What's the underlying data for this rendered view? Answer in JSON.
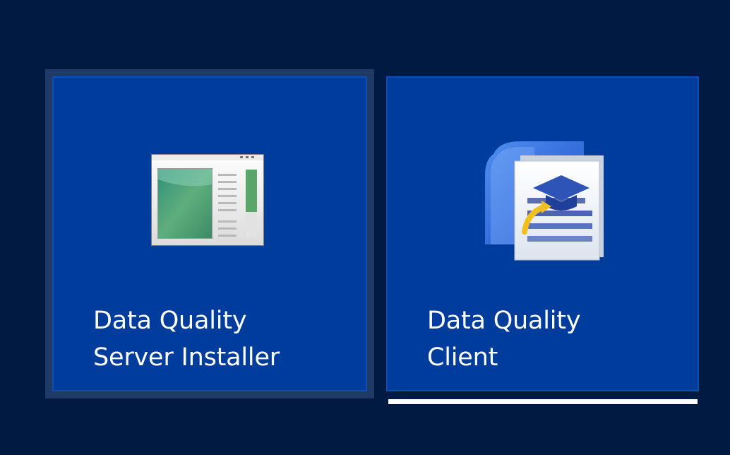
{
  "tiles": [
    {
      "label_line1": "Data Quality",
      "label_line2": "Server Installer",
      "icon": "installer-window-icon"
    },
    {
      "label_line1": "Data Quality",
      "label_line2": "Client",
      "icon": "data-quality-client-icon"
    }
  ],
  "colors": {
    "background": "#011a41",
    "tile": "#003c9b",
    "focus_frame": "#1f3a64",
    "selection_bar": "#ffffff"
  }
}
